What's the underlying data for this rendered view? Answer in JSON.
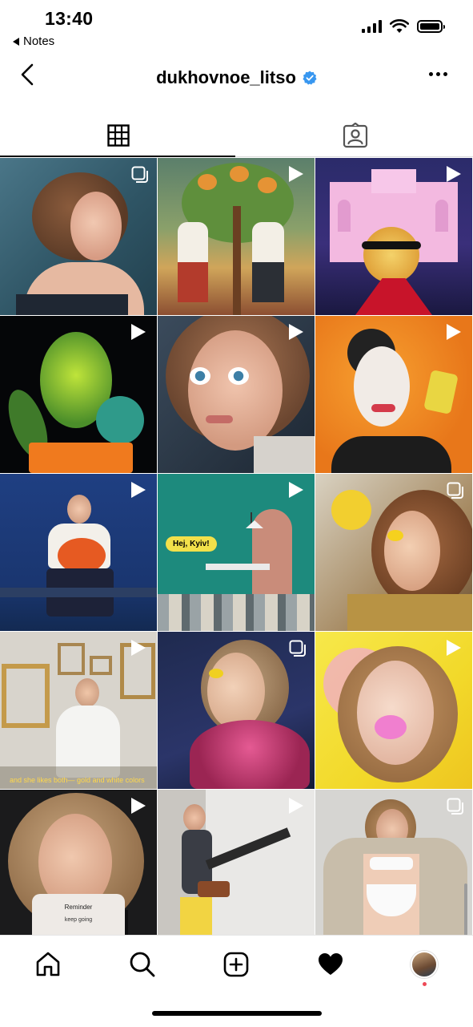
{
  "status_bar": {
    "time": "13:40",
    "back_app": "Notes"
  },
  "header": {
    "username": "dukhovnoe_litso",
    "verified": true
  },
  "tabs": [
    {
      "name": "posts-grid",
      "icon": "grid-icon",
      "active": true
    },
    {
      "name": "tagged",
      "icon": "tagged-person-icon",
      "active": false
    }
  ],
  "posts": [
    {
      "type": "carousel",
      "icon": "multiple-posts-icon"
    },
    {
      "type": "reel",
      "icon": "reel-play-icon"
    },
    {
      "type": "reel",
      "icon": "reel-play-icon"
    },
    {
      "type": "reel",
      "icon": "reel-play-icon"
    },
    {
      "type": "reel",
      "icon": "reel-play-icon"
    },
    {
      "type": "reel",
      "icon": "reel-play-icon"
    },
    {
      "type": "reel",
      "icon": "reel-play-icon"
    },
    {
      "type": "reel",
      "icon": "reel-play-icon",
      "overlay_text": "Hej, Kyiv!"
    },
    {
      "type": "carousel",
      "icon": "multiple-posts-icon"
    },
    {
      "type": "reel",
      "icon": "reel-play-icon",
      "overlay_text": "and she likes both— gold and white colors"
    },
    {
      "type": "carousel",
      "icon": "multiple-posts-icon"
    },
    {
      "type": "reel",
      "icon": "reel-play-icon"
    },
    {
      "type": "reel",
      "icon": "reel-play-icon",
      "overlay_title": "Reminder",
      "overlay_subtitle": "keep going"
    },
    {
      "type": "reel",
      "icon": "reel-play-icon"
    },
    {
      "type": "carousel",
      "icon": "multiple-posts-icon"
    }
  ],
  "bottom_nav": [
    {
      "name": "home",
      "icon": "home-icon"
    },
    {
      "name": "search",
      "icon": "search-icon"
    },
    {
      "name": "create",
      "icon": "plus-square-icon"
    },
    {
      "name": "activity",
      "icon": "heart-icon"
    },
    {
      "name": "profile",
      "icon": "profile-avatar-icon",
      "notification_dot": true
    }
  ],
  "colors": {
    "accent_verified": "#3897f0",
    "notification": "#ed4956"
  }
}
